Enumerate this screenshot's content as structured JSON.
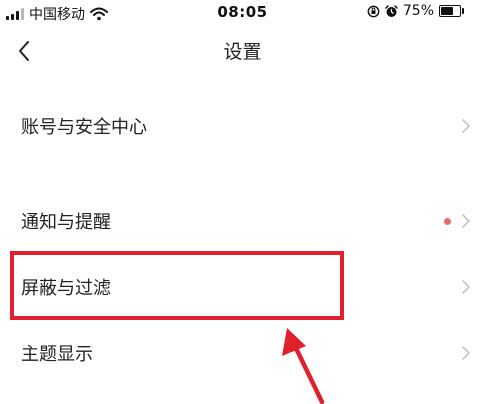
{
  "status_bar": {
    "carrier": "中国移动",
    "time": "08:05",
    "battery_percent": "75%",
    "battery_level": 0.75,
    "icons": [
      "signal-icon",
      "wifi-icon",
      "orientation-lock-icon",
      "alarm-icon",
      "battery-icon"
    ]
  },
  "nav": {
    "title": "设置",
    "back_icon": "chevron-left-icon"
  },
  "settings": {
    "items": [
      {
        "label": "账号与安全中心",
        "badge": false
      },
      {
        "label": "通知与提醒",
        "badge": true
      },
      {
        "label": "屏蔽与过滤",
        "badge": false,
        "highlighted": true
      },
      {
        "label": "主题显示",
        "badge": false
      }
    ]
  },
  "annotation": {
    "highlight_color": "#e0202d",
    "arrow_color": "#e0202d",
    "target": "屏蔽与过滤"
  },
  "colors": {
    "badge": "#e2706f",
    "chevron": "#c4c4c4",
    "text": "#222222"
  }
}
